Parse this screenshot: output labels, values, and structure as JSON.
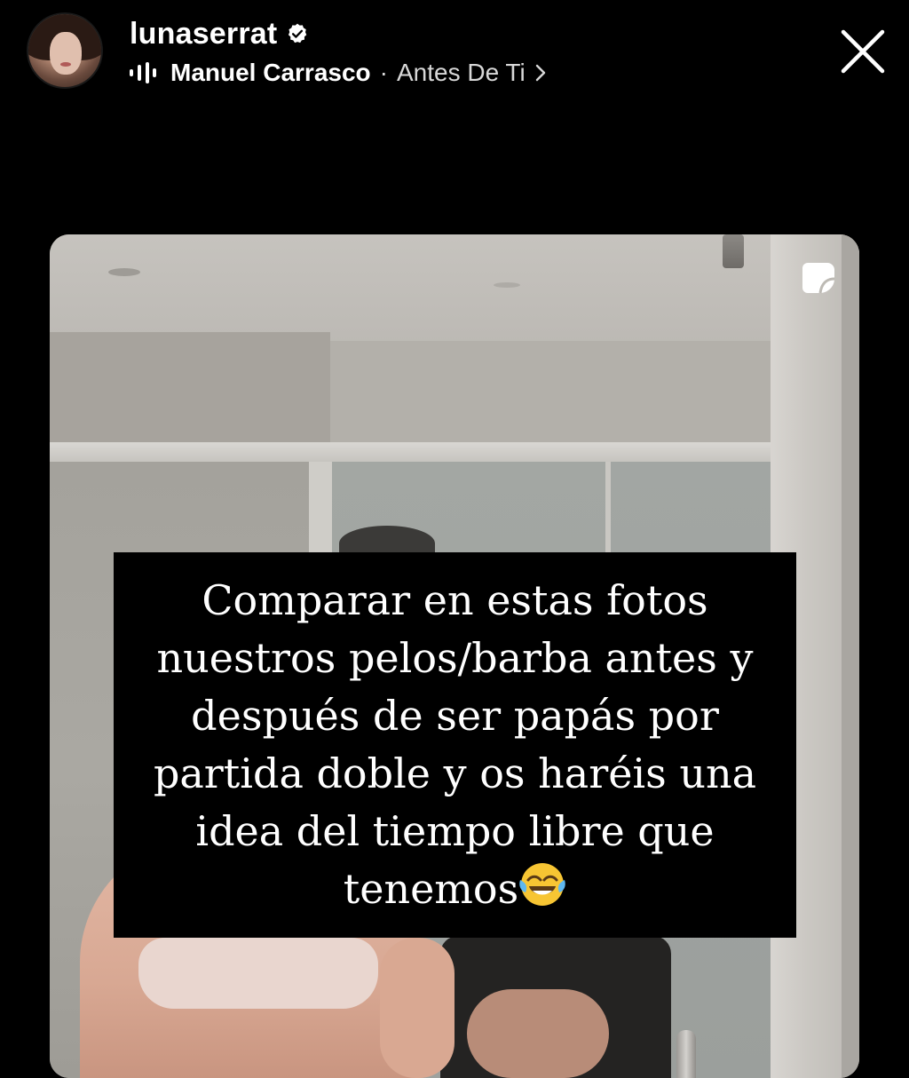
{
  "header": {
    "username": "lunaserrat",
    "verified": true,
    "music": {
      "artist": "Manuel Carrasco",
      "separator": "·",
      "song": "Antes De Ti",
      "chevron": "›"
    }
  },
  "story": {
    "caption": "Comparar en estas fotos\nnuestros pelos/barba antes y\ndespués de ser papás por\npartida doble y os haréis una\nidea del tiempo libre que\ntenemos",
    "caption_emoji": "face-with-tears-of-joy-icon"
  },
  "icons": {
    "verified": "verified-badge-icon",
    "music": "waveform-icon",
    "close": "close-icon",
    "sticker": "sticker-icon"
  },
  "colors": {
    "background": "#000000",
    "text": "#ffffff",
    "secondary_text": "#d8d8d8",
    "caption_box": "#000000"
  }
}
